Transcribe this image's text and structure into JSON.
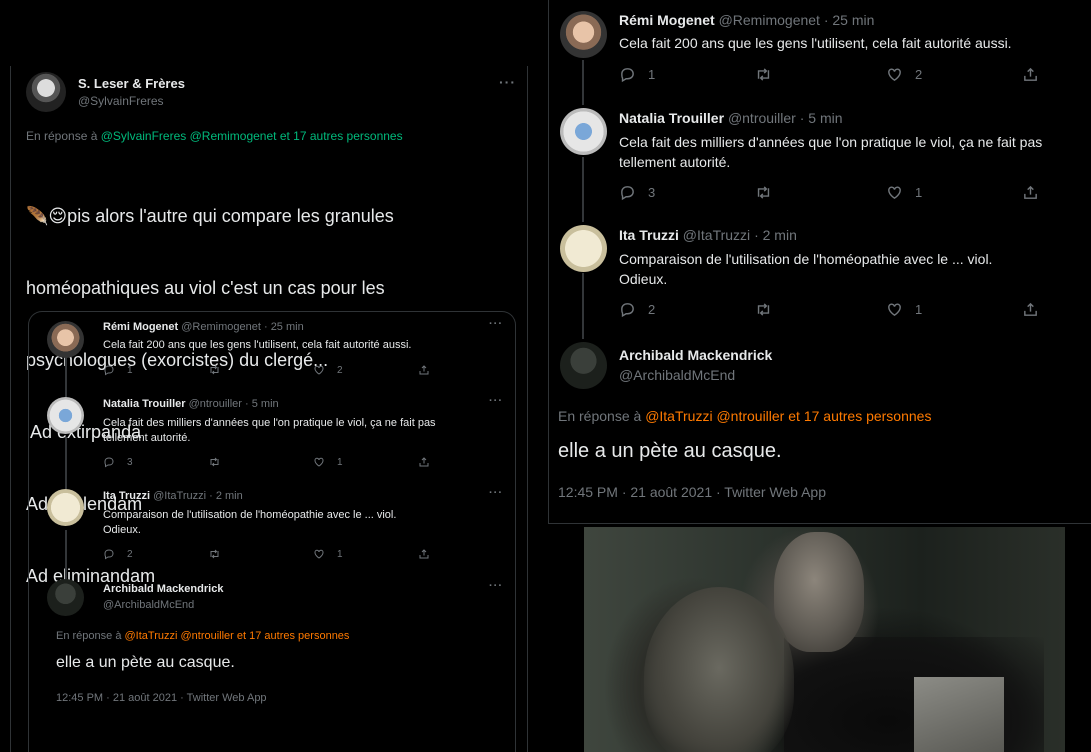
{
  "left_tweet": {
    "author_name": "S. Leser & Frères",
    "author_handle": "@SylvainFreres",
    "more": "···",
    "reply_prefix": "En réponse à",
    "reply_mentions": "@SylvainFreres @Remimogenet",
    "reply_others": "et 17 autres personnes",
    "text_lines": [
      "🪶😌pis alors l'autre qui compare les granules",
      "homéopathiques au viol c'est un cas pour les",
      "psychologues (exorcistes) du clergé...",
      " Ad extirpanda",
      "Ad abolendam",
      "Ad eliminandam"
    ],
    "accent_color": "#00ba7c"
  },
  "thread": [
    {
      "name": "Rémi Mogenet",
      "handle": "@Remimogenet",
      "time": "· 25 min",
      "text": [
        "Cela fait 200 ans que les gens l'utilisent, cela fait autorité aussi."
      ],
      "replies": "1",
      "retweets": "",
      "likes": "2"
    },
    {
      "name": "Natalia Trouiller",
      "handle": "@ntrouiller",
      "time": "· 5 min",
      "text": [
        "Cela fait des milliers d'années que l'on pratique le viol, ça ne fait pas",
        "tellement autorité."
      ],
      "replies": "3",
      "retweets": "",
      "likes": "1"
    },
    {
      "name": "Ita Truzzi",
      "handle": "@ItaTruzzi",
      "time": "· 2 min",
      "text": [
        "Comparaison de l'utilisation de l'homéopathie avec le ... viol.",
        "Odieux."
      ],
      "replies": "2",
      "retweets": "",
      "likes": "1"
    }
  ],
  "main_tweet": {
    "name": "Archibald Mackendrick",
    "handle": "@ArchibaldMcEnd",
    "reply_prefix": "En réponse à",
    "reply_mentions": "@ItaTruzzi @ntrouiller",
    "reply_others": "et 17 autres personnes",
    "text": "elle a un pète au casque.",
    "meta": "12:45 PM · 21 août 2021 · Twitter Web App",
    "accent_color": "#ff7a00"
  },
  "icons": {
    "reply": "reply-icon",
    "retweet": "retweet-icon",
    "like": "heart-icon",
    "share": "share-icon",
    "more": "more-icon"
  }
}
